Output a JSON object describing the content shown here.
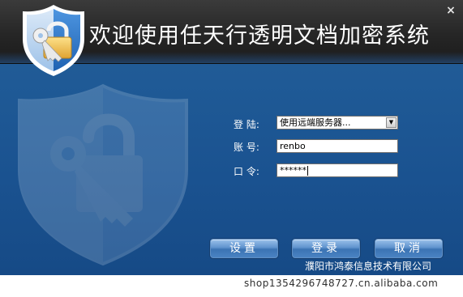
{
  "window": {
    "title": "欢迎使用任天行透明文档加密系统",
    "close_glyph": "×"
  },
  "icons": {
    "logo": "shield-lock-key-icon",
    "watermark": "shield-lock-key-watermark-icon",
    "close": "close-icon",
    "dropdown": "chevron-down-icon"
  },
  "form": {
    "login_label": "登 陆:",
    "login_value": "使用远端服务器...",
    "account_label": "账 号:",
    "account_value": "renbo",
    "password_label": "口 令:",
    "password_value": "******"
  },
  "buttons": {
    "settings": "设置",
    "login": "登录",
    "cancel": "取消"
  },
  "footer": {
    "company": "濮阳市鸿泰信息技术有限公司",
    "watermark_text": "shop1354296748727.cn.alibaba.com"
  },
  "colors": {
    "titlebar": "#262626",
    "window_bg": "#1f5a96",
    "button": "#5f93ce"
  }
}
